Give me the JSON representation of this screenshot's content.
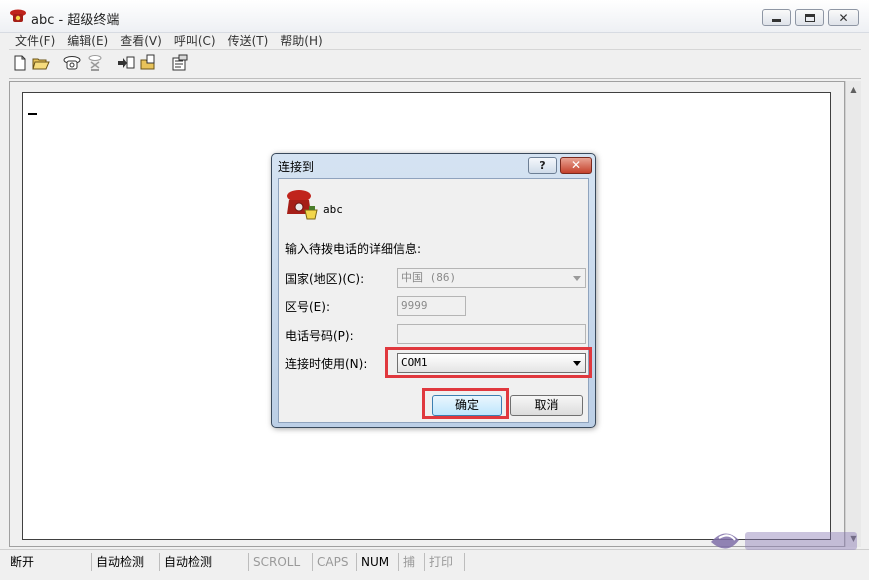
{
  "window": {
    "title": "abc - 超级终端",
    "icon": "phone-icon",
    "controls": [
      "minimize-icon",
      "maximize-icon",
      "close-icon"
    ]
  },
  "menu": {
    "items": [
      "文件(F)",
      "编辑(E)",
      "查看(V)",
      "呼叫(C)",
      "传送(T)",
      "帮助(H)"
    ]
  },
  "toolbar": {
    "buttons": [
      "new-file-icon",
      "open-folder-icon",
      "call-icon",
      "disconnect-icon",
      "send-icon",
      "receive-icon",
      "properties-icon"
    ]
  },
  "terminal": {
    "cursor": "_"
  },
  "status": {
    "connection": "断开",
    "detect1": "自动检测",
    "detect2": "自动检测",
    "scroll": "SCROLL",
    "caps": "CAPS",
    "num": "NUM",
    "capture": "捕",
    "print": "打印"
  },
  "dialog": {
    "title": "连接到",
    "help_label": "?",
    "close_label": "✕",
    "connection_name": "abc",
    "prompt": "输入待拨电话的详细信息:",
    "country_label": "国家(地区)(C):",
    "country_value": "中国 (86)",
    "area_label": "区号(E):",
    "area_value": "9999",
    "phone_label": "电话号码(P):",
    "phone_value": "",
    "connect_using_label": "连接时使用(N):",
    "connect_using_value": "COM1",
    "ok_label": "确定",
    "cancel_label": "取消"
  },
  "colors": {
    "highlight": "#e0383e",
    "dialog_frame": "#bccfe6"
  }
}
